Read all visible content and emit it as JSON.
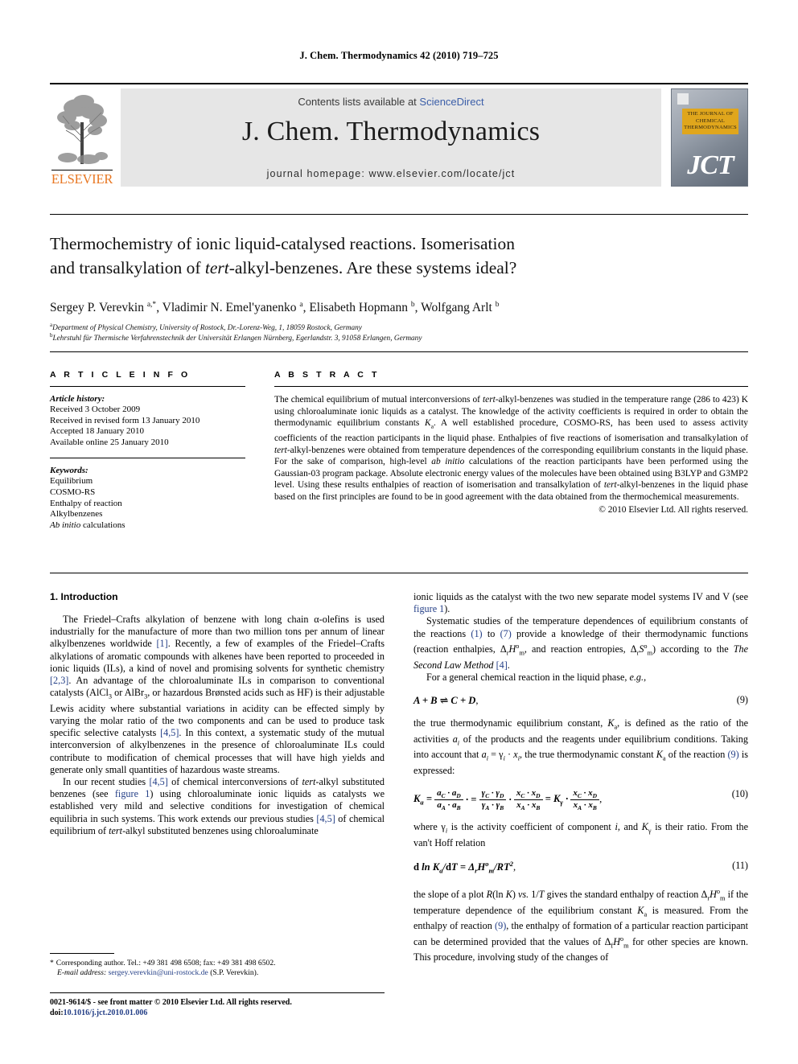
{
  "running_head": "J. Chem. Thermodynamics 42 (2010) 719–725",
  "masthead": {
    "contents_prefix": "Contents lists available at ",
    "sciencedirect": "ScienceDirect",
    "journal_title": "J. Chem. Thermodynamics",
    "homepage": "journal homepage: www.elsevier.com/locate/jct",
    "publisher_word": "ELSEVIER",
    "cover_title": "THE JOURNAL OF CHEMICAL THERMODYNAMICS",
    "cover_abbrev": "JCT",
    "link_color": "#3b5ea8",
    "banner_color": "#e6e6e6",
    "elsevier_orange": "#e87722",
    "cover_gold": "#e0a61c"
  },
  "article": {
    "title_line1": "Thermochemistry of ionic liquid-catalysed reactions. Isomerisation",
    "title_line2_pre": "and transalkylation of ",
    "title_line2_it": "tert",
    "title_line2_post": "-alkyl-benzenes. Are these systems ideal?",
    "authors_plain": "Sergey P. Verevkin a,*, Vladimir N. Emel'yanenko a, Elisabeth Hopmann b, Wolfgang Arlt b",
    "affiliation_a": "Department of Physical Chemistry, University of Rostock, Dr.-Lorenz-Weg, 1, 18059 Rostock, Germany",
    "affiliation_b": "Lehrstuhl für Thermische Verfahrenstechnik der Universität Erlangen Nürnberg, Egerlandstr. 3, 91058 Erlangen, Germany"
  },
  "article_info": {
    "heading": "A R T I C L E    I N F O",
    "history_label": "Article history:",
    "history": [
      "Received 3 October 2009",
      "Received in revised form 13 January 2010",
      "Accepted 18 January 2010",
      "Available online 25 January 2010"
    ],
    "keywords_label": "Keywords:",
    "keywords": [
      "Equilibrium",
      "COSMO-RS",
      "Enthalpy of reaction",
      "Alkylbenzenes",
      "Ab initio calculations"
    ]
  },
  "abstract": {
    "heading": "A B S T R A C T",
    "paragraph": "The chemical equilibrium of mutual interconversions of tert-alkyl-benzenes was studied in the temperature range (286 to 423) K using chloroaluminate ionic liquids as a catalyst. The knowledge of the activity coefficients is required in order to obtain the thermodynamic equilibrium constants Ka. A well established procedure, COSMO-RS, has been used to assess activity coefficients of the reaction participants in the liquid phase. Enthalpies of five reactions of isomerisation and transalkylation of tert-alkyl-benzenes were obtained from temperature dependences of the corresponding equilibrium constants in the liquid phase. For the sake of comparison, high-level ab initio calculations of the reaction participants have been performed using the Gaussian-03 program package. Absolute electronic energy values of the molecules have been obtained using B3LYP and G3MP2 level. Using these results enthalpies of reaction of isomerisation and transalkylation of tert-alkyl-benzenes in the liquid phase based on the first principles are found to be in good agreement with the data obtained from the thermochemical measurements.",
    "copyright": "© 2010 Elsevier Ltd. All rights reserved."
  },
  "body": {
    "intro_heading": "1. Introduction",
    "left_p1": "The Friedel–Crafts alkylation of benzene with long chain α-olefins is used industrially for the manufacture of more than two million tons per annum of linear alkylbenzenes worldwide [1]. Recently, a few of examples of the Friedel–Crafts alkylations of aromatic compounds with alkenes have been reported to proceeded in ionic liquids (ILs), a kind of novel and promising solvents for synthetic chemistry [2,3]. An advantage of the chloroaluminate ILs in comparison to conventional catalysts (AlCl3 or AlBr3, or hazardous Brønsted acids such as HF) is their adjustable Lewis acidity where substantial variations in acidity can be effected simply by varying the molar ratio of the two components and can be used to produce task specific selective catalysts [4,5]. In this context, a systematic study of the mutual interconversion of alkylbenzenes in the presence of chloroaluminate ILs could contribute to modification of chemical processes that will have high yields and generate only small quantities of hazardous waste streams.",
    "left_p2": "In our recent studies [4,5] of chemical interconversions of tert-alkyl substituted benzenes (see figure 1) using chloroaluminate ionic liquids as catalysts we established very mild and selective conditions for investigation of chemical equilibria in such systems. This work extends our previous studies [4,5] of chemical equilibrium of tert-alkyl substituted benzenes using chloroaluminate",
    "right_p0": "ionic liquids as the catalyst with the two new separate model systems IV and V (see figure 1).",
    "right_p1": "Systematic studies of the temperature dependences of equilibrium constants of the reactions (1) to (7) provide a knowledge of their thermodynamic functions (reaction enthalpies, ΔrH°m, and reaction entropies, ΔrS°m) according to the The Second Law Method [4].",
    "right_p2": "For a general chemical reaction in the liquid phase, e.g.,",
    "eq9_num": "(9)",
    "right_p3": "the true thermodynamic equilibrium constant, Ka, is defined as the ratio of the activities ai of the products and the reagents under equilibrium conditions. Taking into account that ai = γi · xi, the true thermodynamic constant Ka of the reaction (9) is expressed:",
    "eq10_num": "(10)",
    "right_p4": "where γi is the activity coefficient of component i, and Kγ is their ratio. From the van't Hoff relation",
    "eq11_num": "(11)",
    "right_p5": "the slope of a plot R(ln K) vs. 1/T gives the standard enthalpy of reaction ΔrH°m if the temperature dependence of the equilibrium constant Ka is measured. From the enthalpy of reaction (9), the enthalpy of formation of a particular reaction participant can be determined provided that the values of ΔfH°m for other species are known. This procedure, involving study of the changes of"
  },
  "footnote": {
    "marker": "*",
    "text_before_email": "Corresponding author. Tel.: +49 381 498 6508; fax: +49 381 498 6502.",
    "email_label": "E-mail address:",
    "email": "sergey.verevkin@uni-rostock.de",
    "email_suffix": "(S.P. Verevkin)."
  },
  "footer": {
    "line1": "0021-9614/$ - see front matter © 2010 Elsevier Ltd. All rights reserved.",
    "doi_label": "doi:",
    "doi": "10.1016/j.jct.2010.01.006"
  }
}
